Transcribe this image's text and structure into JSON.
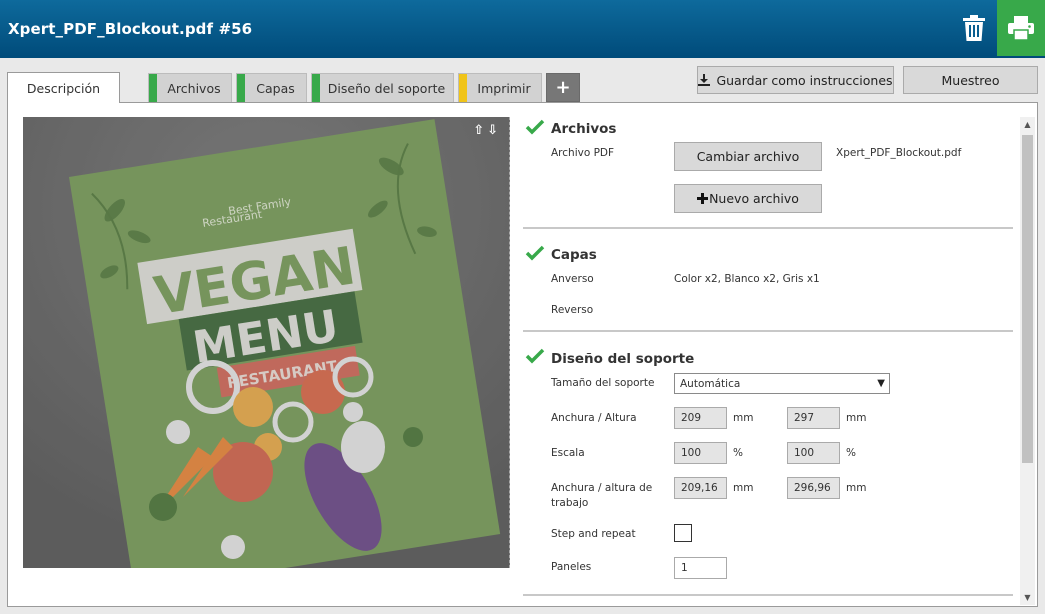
{
  "header": {
    "title": "Xpert_PDF_Blockout.pdf #56"
  },
  "tabs": [
    {
      "label": "Descripción"
    },
    {
      "label": "Archivos",
      "stripe": "#38a94a"
    },
    {
      "label": "Capas",
      "stripe": "#38a94a"
    },
    {
      "label": "Diseño del soporte",
      "stripe": "#38a94a"
    },
    {
      "label": "Imprimir",
      "stripe": "#f0c419"
    },
    {
      "label": "+"
    }
  ],
  "toolbar": {
    "save_label": "Guardar como instrucciones",
    "proof_label": "Muestreo"
  },
  "preview": {
    "arrows": "⇧⇩",
    "poster": {
      "line1": "Best Family",
      "line2": "Restaurant",
      "vegan": "VEGAN",
      "menu": "MENU",
      "restaurant": "RESTAURANT"
    }
  },
  "archivos": {
    "title": "Archivos",
    "pdf_label": "Archivo PDF",
    "change_button": "Cambiar archivo",
    "filename": "Xpert_PDF_Blockout.pdf",
    "new_button": "Nuevo archivo"
  },
  "capas": {
    "title": "Capas",
    "front_label": "Anverso",
    "front_value": "Color x2, Blanco x2, Gris x1",
    "back_label": "Reverso"
  },
  "diseno": {
    "title": "Diseño del soporte",
    "size_label": "Tamaño del soporte",
    "size_value": "Automática",
    "wh_label": "Anchura / Altura",
    "width": "209",
    "height": "297",
    "unit_mm": "mm",
    "scale_label": "Escala",
    "scale_x": "100",
    "scale_y": "100",
    "unit_pct": "%",
    "work_label_1": "Anchura / altura de",
    "work_label_2": "trabajo",
    "work_w": "209,16",
    "work_h": "296,96",
    "step_label": "Step and repeat",
    "panels_label": "Paneles",
    "panels_value": "1"
  },
  "colors": {
    "header": "#00578a",
    "print": "#38a94a",
    "check": "#38a94a"
  }
}
